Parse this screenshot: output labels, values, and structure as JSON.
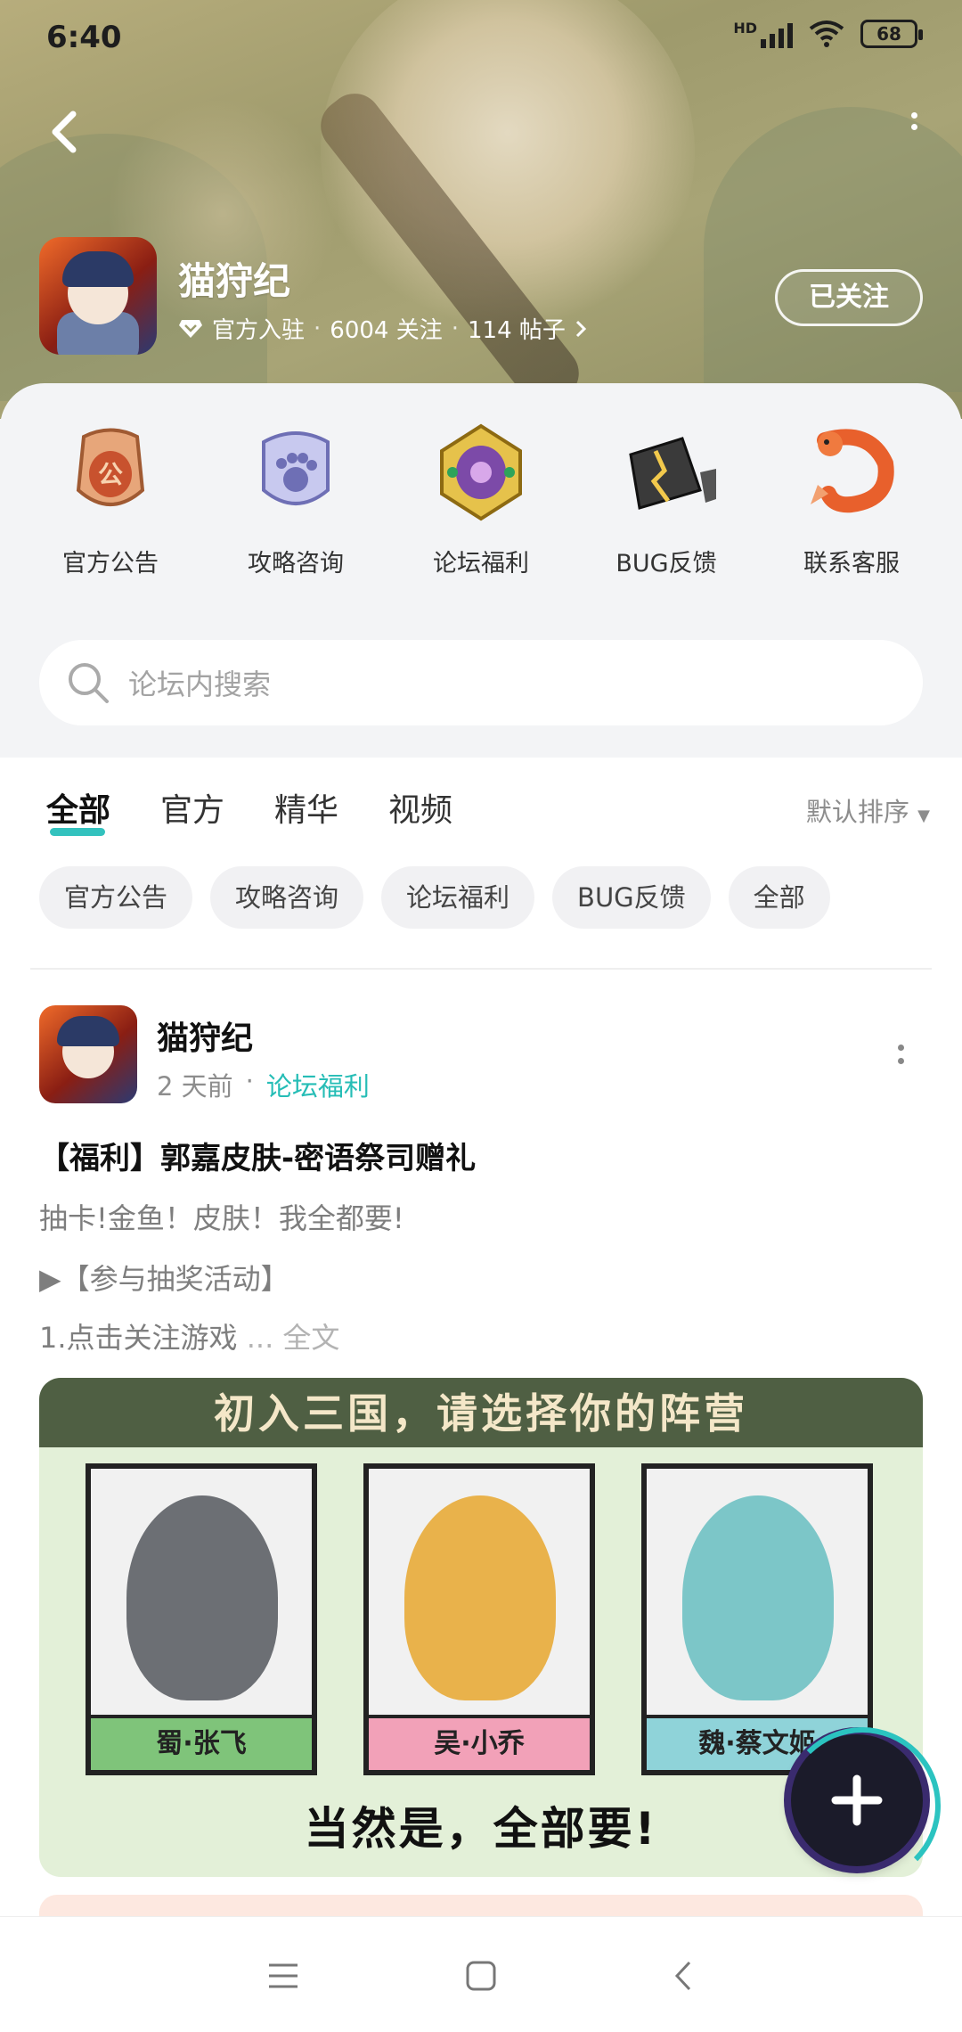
{
  "status_bar": {
    "time": "6:40",
    "network": "HD",
    "battery": "68"
  },
  "header": {
    "game_name": "猫狩纪",
    "badge": "官方入驻",
    "followers": "6004 关注",
    "posts": "114 帖子",
    "follow_label": "已关注"
  },
  "shortcuts": [
    {
      "label": "官方公告",
      "icon": "announcement-badge-icon"
    },
    {
      "label": "攻略咨询",
      "icon": "paw-shield-icon"
    },
    {
      "label": "论坛福利",
      "icon": "gem-amulet-icon"
    },
    {
      "label": "BUG反馈",
      "icon": "cracked-stone-icon"
    },
    {
      "label": "联系客服",
      "icon": "koi-fish-icon"
    }
  ],
  "search": {
    "placeholder": "论坛内搜索"
  },
  "tabs": [
    {
      "label": "全部",
      "active": true
    },
    {
      "label": "官方",
      "active": false
    },
    {
      "label": "精华",
      "active": false
    },
    {
      "label": "视频",
      "active": false
    }
  ],
  "sort_label": "默认排序",
  "chips": [
    "官方公告",
    "攻略咨询",
    "论坛福利",
    "BUG反馈",
    "全部"
  ],
  "post": {
    "author": "猫狩纪",
    "time": "2 天前",
    "category": "论坛福利",
    "title": "【福利】郭嘉皮肤-密语祭司赠礼",
    "line1": "抽卡!金鱼！皮肤！我全都要!",
    "line2": "▶【参与抽奖活动】",
    "line3": "1.点击关注游戏",
    "more": "... 全文",
    "image": {
      "heading": "初入三国，请选择你的阵营",
      "cards": [
        "蜀·张飞",
        "吴·小乔",
        "魏·蔡文姬"
      ],
      "caption": "当然是，全部要!"
    }
  },
  "colors": {
    "accent": "#33c2be",
    "category": "#26bdb6"
  }
}
